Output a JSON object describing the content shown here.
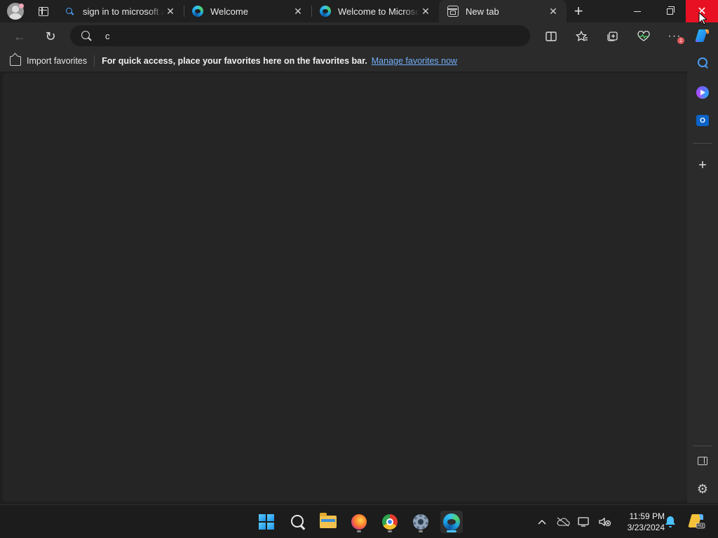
{
  "tabs": [
    {
      "title": "sign in to microsoft ac",
      "favicon": "search-icon",
      "active": false
    },
    {
      "title": "Welcome",
      "favicon": "edge-icon",
      "active": false
    },
    {
      "title": "Welcome to Microsoft",
      "favicon": "edge-icon",
      "active": false
    },
    {
      "title": "New tab",
      "favicon": "new-tab-icon",
      "active": true
    }
  ],
  "window_controls": {
    "minimize": "–",
    "restore": "❐",
    "close": "✕"
  },
  "toolbar": {
    "back": "←",
    "refresh": "↻",
    "address_value": "c",
    "split_screen": "⧉",
    "favorites": "☆",
    "collections": "⧉",
    "health": "♡",
    "more": "···",
    "more_badge": "1"
  },
  "favorites_bar": {
    "import_label": "Import favorites",
    "message": "For quick access, place your favorites here on the favorites bar.",
    "link": "Manage favorites now"
  },
  "sidebar": {
    "add": "+",
    "outlook_letter": "O",
    "settings": "⚙"
  },
  "taskbar": {
    "time": "11:59 PM",
    "date": "3/23/2024",
    "tray_chevron": "^"
  },
  "colors": {
    "accent": "#4cc2ff",
    "close_button": "#e81123",
    "link": "#72aef8"
  }
}
